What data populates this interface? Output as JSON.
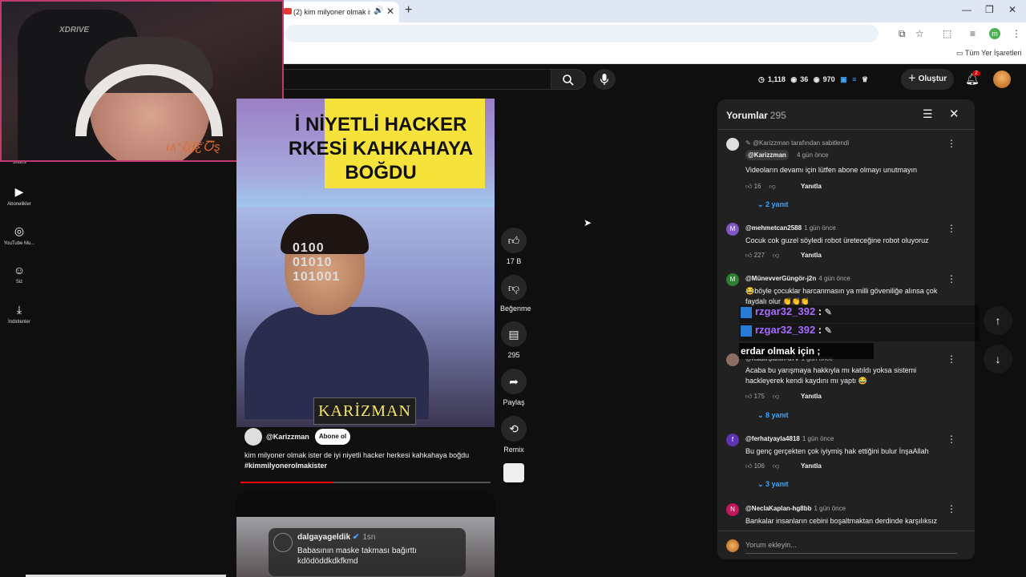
{
  "browser": {
    "tab_title": "(2) kim milyoner olmak ister",
    "tab_speaker": "🔊",
    "tab_close": "✕",
    "new_tab": "+",
    "win_min": "—",
    "win_max": "❐",
    "win_close": "✕",
    "profile_initial": "m",
    "bookmarks_label": "Tüm Yer İşaretleri"
  },
  "header": {
    "search_placeholder": "a",
    "stats": [
      "1,118",
      "36",
      "970"
    ],
    "create_label": "Oluştur",
    "notif_count": "2"
  },
  "sidebar": [
    {
      "label": "Shorts"
    },
    {
      "label": "Abonelikler"
    },
    {
      "label": "YouTube Mu..."
    },
    {
      "label": "Siz"
    },
    {
      "label": "İndirilenler"
    }
  ],
  "webcam": {
    "brand": "XDRIVE",
    "overlay_text": "ıʌ°ζιʃƹ̈Ⴀ̈ȿ"
  },
  "video": {
    "title_overlay": "İ NİYETLİ HACKER\nRKESİ KAHKAHAYA\nBOĞDU",
    "shirt_text": "0100\n01010\n101001",
    "brand_box": "KARİZMAN",
    "channel": "@Karizzman",
    "subscribe": "Abone ol",
    "description": "kim milyoner olmak ister de iyi niyetli hacker herkesi kahkahaya boğdu",
    "hashtag": "#kimmilyonerolmakister",
    "progress": 0.37
  },
  "video2": {
    "user": "dalgayageldik",
    "time": "1sn",
    "text": "Babasının maske takması bağırttı kdödöddkdkfkmd"
  },
  "actions": [
    {
      "label": "17 B"
    },
    {
      "label": "Beğenme"
    },
    {
      "label": "295"
    },
    {
      "label": "Paylaş"
    },
    {
      "label": "Remix"
    }
  ],
  "comments": {
    "title": "Yorumlar",
    "count": "295",
    "pinned_label": "@Karizzman tarafından sabitlendi",
    "items": [
      {
        "user": "@Karizzman",
        "time": "4 gün önce",
        "text": "Videoların devamı için lütfen abone olmayı unutmayın",
        "likes": "16",
        "replies": "2 yanıt",
        "initial": ""
      },
      {
        "user": "@mehmetcan2588",
        "time": "1 gün önce",
        "text": "Cocuk cok guzel söyledi robot üreteceğine robot oluyoruz",
        "likes": "227",
        "replies": "",
        "initial": "M"
      },
      {
        "user": "@MünevverGüngör-j2n",
        "time": "4 gün önce",
        "text": "😂böyle çocuklar harcanmasın ya milli göveniliğe alınsa çok faydalı olur 👏👏👏",
        "likes": "",
        "replies": "",
        "initial": "M"
      },
      {
        "user": "@KadirŞahin-u7v",
        "time": "1 gün önce",
        "text": "Acaba bu yarışmaya hakkıyla mı katıldı yoksa sistemi hackleyerek kendi kaydını mı yaptı 😂",
        "likes": "175",
        "replies": "8 yanıt",
        "initial": ""
      },
      {
        "user": "@ferhatyayla4818",
        "time": "1 gün önce",
        "text": "Bu genç gerçekten çok iyiymiş hak ettiğini bulur İnşaAllah",
        "likes": "106",
        "replies": "3 yanıt",
        "initial": "f"
      },
      {
        "user": "@NeclaKaplan-hg8bb",
        "time": "1 gün önce",
        "text": "Bankalar insanların cebini boşaltmaktan derdinde karşılıksız",
        "likes": "",
        "replies": "",
        "initial": "N"
      }
    ],
    "reply_label": "Yanıtla",
    "add_placeholder": "Yorum ekleyin..."
  },
  "chat": {
    "user1": "rzgar32_392",
    "user2": "rzgar32_392",
    "line": "erdar olmak için ;"
  },
  "colors": {
    "accent": "#ff0000",
    "link": "#3ea6ff",
    "chat_user": "#a66bff"
  }
}
